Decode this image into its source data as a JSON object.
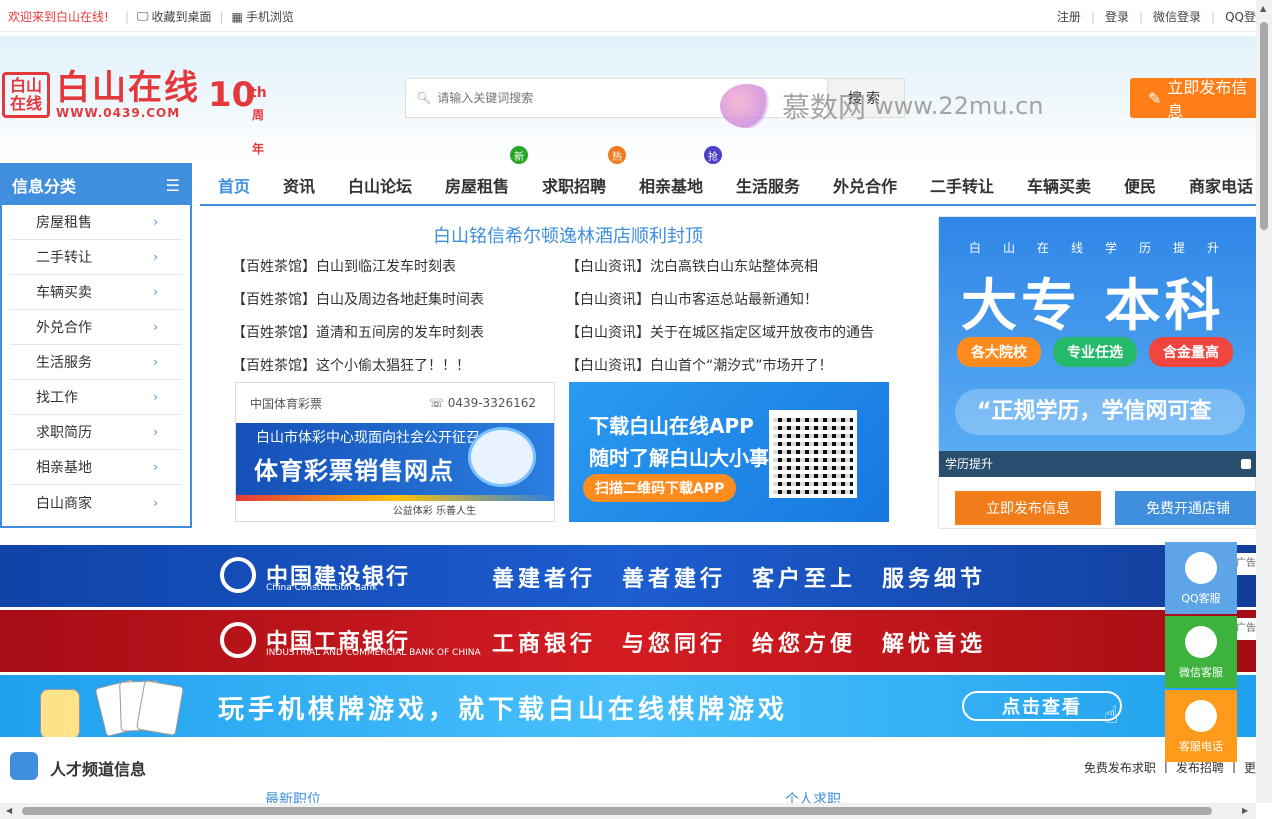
{
  "topbar": {
    "welcome": "欢迎来到白山在线!",
    "bookmark": "收藏到桌面",
    "mobile": "手机浏览",
    "register": "注册",
    "login": "登录",
    "wechat_login": "微信登录",
    "qq_login": "QQ登"
  },
  "logo": {
    "mark": "白山在线",
    "name": "白山在线",
    "url": "WWW.0439.COM",
    "years": "10",
    "th": "th",
    "zhou": "周年"
  },
  "search": {
    "placeholder": "请输入关键词搜索",
    "button": "搜索"
  },
  "watermark": {
    "cn": "慕数网",
    "url": "www.22mu.cn"
  },
  "publish_top": "立即发布信息",
  "categories": {
    "title": "信息分类",
    "items": [
      "房屋租售",
      "二手转让",
      "车辆买卖",
      "外兑合作",
      "生活服务",
      "找工作",
      "求职简历",
      "相亲基地",
      "白山商家"
    ]
  },
  "nav": {
    "items": [
      "首页",
      "资讯",
      "白山论坛",
      "房屋租售",
      "求职招聘",
      "相亲基地",
      "生活服务",
      "外兑合作",
      "二手转让",
      "车辆买卖",
      "便民",
      "商家电话"
    ],
    "badges": {
      "new": "新",
      "hot": "热",
      "grab": "抢"
    },
    "colors": {
      "new": "#2aa52a",
      "hot": "#ef7b22",
      "grab": "#4a3fc6"
    }
  },
  "headline": "白山铭信希尔顿逸林酒店顺利封顶",
  "news_left": [
    "【百姓茶馆】白山到临江发车时刻表",
    "【百姓茶馆】白山及周边各地赶集时间表",
    "【百姓茶馆】道清和五间房的发车时刻表",
    "【百姓茶馆】这个小偷太猖狂了！！！"
  ],
  "news_right": [
    "【白山资讯】沈白高铁白山东站整体亮相",
    "【白山资讯】白山市客运总站最新通知！",
    "【白山资讯】关于在城区指定区域开放夜市的通告",
    "【白山资讯】白山首个“潮汐式”市场开了！"
  ],
  "ad_lottery": {
    "org": "中国体育彩票",
    "phone": "0439-3326162",
    "line1": "白山市体彩中心现面向社会公开征召",
    "line2": "体育彩票销售网点",
    "foot": "公益体彩 乐善人生"
  },
  "ad_app": {
    "line1": "下载白山在线APP",
    "line2": "随时了解白山大小事",
    "line3": "扫描二维码下载APP"
  },
  "right_ad": {
    "sub": "白山在线学历提升",
    "big": "大专 本科",
    "pills": [
      "各大院校",
      "专业任选",
      "含金量高"
    ],
    "slogan": "“正规学历，学信网可查",
    "caption": "学历提升",
    "btn_publish": "立即发布信息",
    "btn_shop": "免费开通店铺"
  },
  "banners": {
    "ccb_cn": "中国建设银行",
    "ccb_en": "China Construction Bank",
    "ccb_slogan": "善建者行　善者建行　客户至上　服务细节",
    "icbc_cn": "中国工商银行",
    "icbc_en": "INDUSTRIAL AND COMMERCIAL BANK OF CHINA",
    "icbc_slogan": "工商银行　与您同行　给您方便　解忧首选",
    "game": "玩手机棋牌游戏，就下载白山在线棋牌游戏",
    "game_btn": "点击查看",
    "adtag": "广告"
  },
  "talent": {
    "title": "人才频道信息",
    "link1": "免费发布求职",
    "link2": "发布招聘",
    "link3": "更",
    "tab1": "最新职位",
    "tab2": "个人求职"
  },
  "float": {
    "qq": "QQ客服",
    "wechat": "微信客服",
    "phone": "客服电话"
  }
}
